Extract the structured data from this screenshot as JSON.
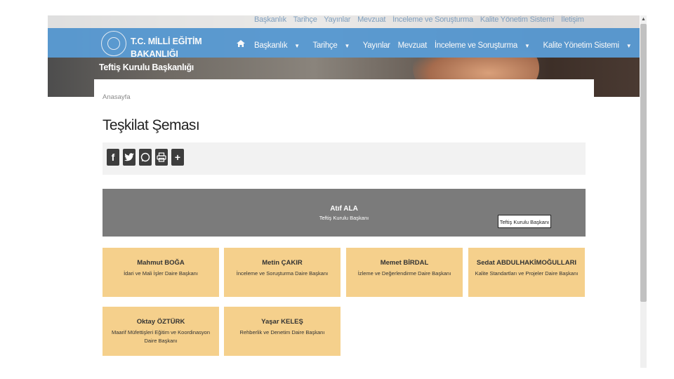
{
  "header": {
    "brand_line1": "T.C. MİLLİ EĞİTİM",
    "brand_line2": "BAKANLIĞI",
    "site_title": "Teftiş Kurulu Başkanlığı",
    "nav": [
      {
        "label": "Başkanlık",
        "dropdown": true
      },
      {
        "label": "Tarihçe",
        "dropdown": true
      },
      {
        "label": "Yayınlar",
        "dropdown": false
      },
      {
        "label": "Mevzuat",
        "dropdown": false
      },
      {
        "label": "İnceleme ve Soruşturma",
        "dropdown": true
      },
      {
        "label": "Kalite Yönetim Sistemi",
        "dropdown": true
      },
      {
        "label": "İletişim",
        "dropdown": false
      }
    ],
    "nav_color": "#5a9bd3"
  },
  "breadcrumb": "Anasayfa",
  "page_title": "Teşkilat Şeması",
  "share": [
    {
      "icon": "facebook-icon",
      "glyph": "f"
    },
    {
      "icon": "twitter-icon",
      "glyph": "t"
    },
    {
      "icon": "whatsapp-icon",
      "glyph": "w"
    },
    {
      "icon": "print-icon",
      "glyph": "p"
    },
    {
      "icon": "plus-icon",
      "glyph": "+"
    }
  ],
  "org": {
    "head": {
      "name": "Atıf ALA",
      "role": "Teftiş Kurulu Başkanı"
    },
    "tooltip": "Teftiş Kurulu Başkanı",
    "units": [
      {
        "name": "Mahmut BOĞA",
        "role": "İdari ve Mali İşler Daire Başkanı"
      },
      {
        "name": "Metin ÇAKIR",
        "role": "İnceleme ve Soruşturma Daire Başkanı"
      },
      {
        "name": "Memet BİRDAL",
        "role": "İzleme ve Değerlendirme Daire Başkanı"
      },
      {
        "name": "Sedat ABDULHAKİMOĞULLARI",
        "role": "Kalite Standartları ve Projeler Daire Başkanı"
      },
      {
        "name": "Oktay ÖZTÜRK",
        "role": "Maarif Müfettişleri Eğitim ve Koordinasyon Daire Başkanı"
      },
      {
        "name": "Yaşar KELEŞ",
        "role": "Rehberlik ve Denetim Daire Başkanı"
      }
    ],
    "head_color": "#7b7b7b",
    "unit_color": "#f5d08c"
  }
}
